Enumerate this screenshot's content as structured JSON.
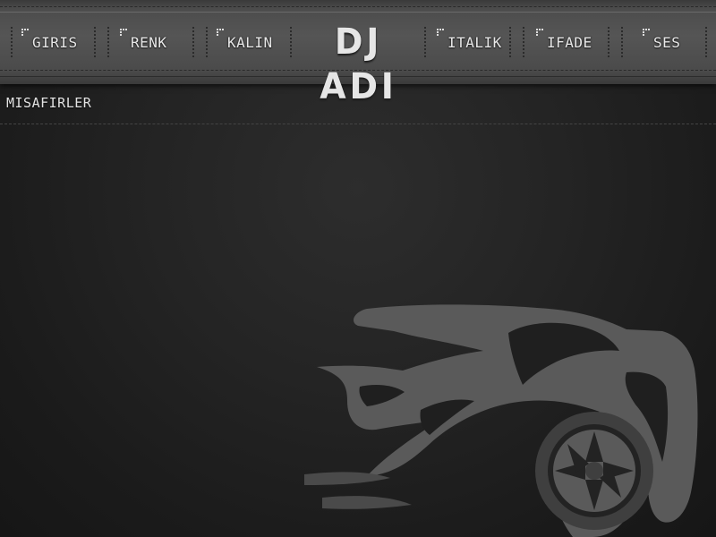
{
  "navigation": {
    "items": [
      {
        "label": "GIRIS"
      },
      {
        "label": "RENK"
      },
      {
        "label": "KALIN"
      },
      {
        "label": "ITALIK"
      },
      {
        "label": "IFADE"
      },
      {
        "label": "SES"
      }
    ],
    "logo_text": "DJ ADI"
  },
  "content": {
    "section_title": "MISAFIRLER"
  },
  "icons": {
    "nav_marker": "dot-matrix-icon",
    "illustration": "sports-car-silhouette"
  },
  "colors": {
    "background": "#1e1e1e",
    "navbar": "#4c4c4c",
    "text": "#e8e8e8",
    "car": "#5a5a5a"
  }
}
